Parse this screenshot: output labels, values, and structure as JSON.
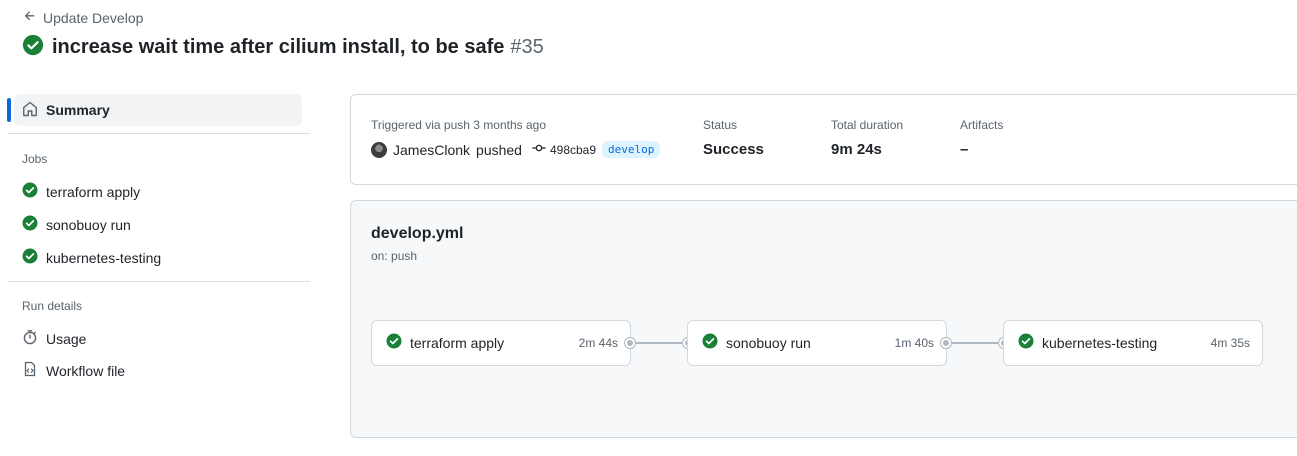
{
  "header": {
    "back_label": "Update Develop",
    "title": "increase wait time after cilium install, to be safe",
    "run_number": "#35"
  },
  "sidebar": {
    "summary_label": "Summary",
    "jobs_heading": "Jobs",
    "jobs": [
      {
        "label": "terraform apply"
      },
      {
        "label": "sonobuoy run"
      },
      {
        "label": "kubernetes-testing"
      }
    ],
    "run_details_heading": "Run details",
    "details": [
      {
        "label": "Usage",
        "icon": "stopwatch-icon"
      },
      {
        "label": "Workflow file",
        "icon": "file-code-icon"
      }
    ]
  },
  "summary": {
    "trigger_label": "Triggered via push 3 months ago",
    "actor": "JamesClonk",
    "action": "pushed",
    "commit_sha": "498cba9",
    "branch": "develop",
    "status_label": "Status",
    "status_value": "Success",
    "duration_label": "Total duration",
    "duration_value": "9m 24s",
    "artifacts_label": "Artifacts",
    "artifacts_value": "–"
  },
  "workflow": {
    "file": "develop.yml",
    "trigger": "on: push",
    "jobs": [
      {
        "name": "terraform apply",
        "duration": "2m 44s"
      },
      {
        "name": "sonobuoy run",
        "duration": "1m 40s"
      },
      {
        "name": "kubernetes-testing",
        "duration": "4m 35s"
      }
    ]
  },
  "colors": {
    "success": "#1a7f37",
    "accent": "#0969da",
    "muted_text": "#59636e",
    "border": "#d1d9e0"
  }
}
